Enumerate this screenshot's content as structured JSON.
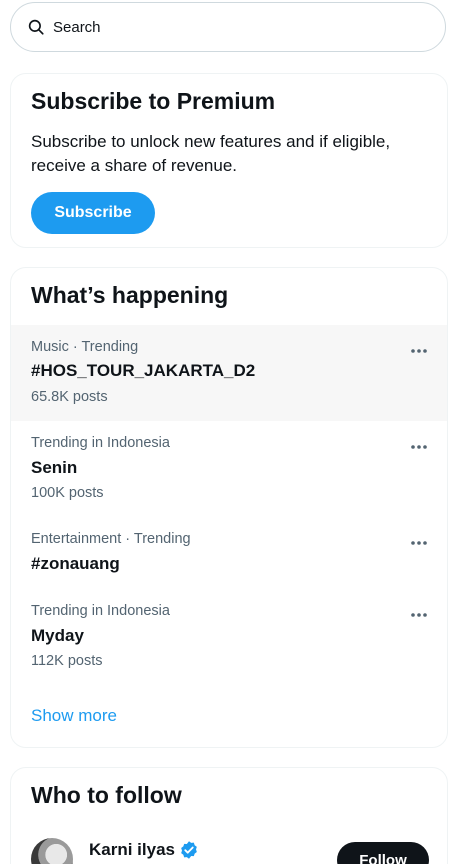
{
  "search": {
    "placeholder": "Search",
    "icon": "search-icon"
  },
  "premium": {
    "title": "Subscribe to Premium",
    "description": "Subscribe to unlock new features and if eligible, receive a share of revenue.",
    "button_label": "Subscribe"
  },
  "happening": {
    "title": "What’s happening",
    "trends": [
      {
        "meta": "Music · Trending",
        "name": "#HOS_TOUR_JAKARTA_D2",
        "count": "65.8K posts"
      },
      {
        "meta": "Trending in Indonesia",
        "name": "Senin",
        "count": "100K posts"
      },
      {
        "meta": "Entertainment · Trending",
        "name": "#zonauang",
        "count": ""
      },
      {
        "meta": "Trending in Indonesia",
        "name": "Myday",
        "count": "112K posts"
      }
    ],
    "show_more": "Show more"
  },
  "who_to_follow": {
    "title": "Who to follow",
    "accounts": [
      {
        "name": "Karni ilyas",
        "verified": true,
        "button_label": "Follow"
      }
    ]
  },
  "colors": {
    "accent": "#1d9bf0",
    "text_primary": "#0f1419",
    "text_secondary": "#536471",
    "border": "#eff3f4",
    "hover_bg": "#f7f7f7",
    "follow_button": "#0f1419"
  }
}
